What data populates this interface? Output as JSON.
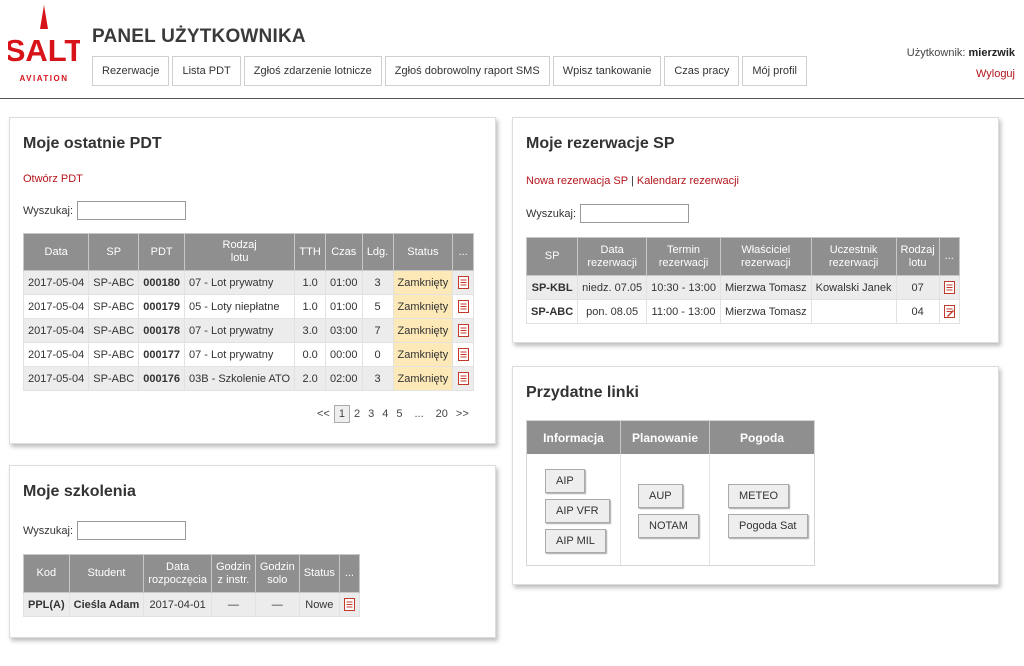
{
  "brand": {
    "logo_text": "SALT",
    "logo_subtext": "AVIATION",
    "accent_color": "#d7141a"
  },
  "header": {
    "title": "PANEL UŻYTKOWNIKA",
    "nav": [
      "Rezerwacje",
      "Lista PDT",
      "Zgłoś zdarzenie lotnicze",
      "Zgłoś dobrowolny raport SMS",
      "Wpisz tankowanie",
      "Czas pracy",
      "Mój profil"
    ],
    "user_label": "Użytkownik:",
    "username": "mierzwik",
    "logout": "Wyloguj"
  },
  "pdt": {
    "title": "Moje ostatnie PDT",
    "open_link": "Otwórz PDT",
    "search_label": "Wyszukaj:",
    "search_value": "",
    "columns": [
      "Data",
      "SP",
      "PDT",
      "Rodzaj lotu",
      "TTH",
      "Czas",
      "Ldg.",
      "Status",
      "..."
    ],
    "rows": [
      {
        "date": "2017-05-04",
        "sp": "SP-ABC",
        "pdt": "000180",
        "type": "07 - Lot prywatny",
        "tth": "1.0",
        "time": "01:00",
        "ldg": "3",
        "status": "Zamknięty"
      },
      {
        "date": "2017-05-04",
        "sp": "SP-ABC",
        "pdt": "000179",
        "type": "05 - Loty niepłatne",
        "tth": "1.0",
        "time": "01:00",
        "ldg": "5",
        "status": "Zamknięty"
      },
      {
        "date": "2017-05-04",
        "sp": "SP-ABC",
        "pdt": "000178",
        "type": "07 - Lot prywatny",
        "tth": "3.0",
        "time": "03:00",
        "ldg": "7",
        "status": "Zamknięty"
      },
      {
        "date": "2017-05-04",
        "sp": "SP-ABC",
        "pdt": "000177",
        "type": "07 - Lot prywatny",
        "tth": "0.0",
        "time": "00:00",
        "ldg": "0",
        "status": "Zamknięty"
      },
      {
        "date": "2017-05-04",
        "sp": "SP-ABC",
        "pdt": "000176",
        "type": "03B - Szkolenie ATO",
        "tth": "2.0",
        "time": "02:00",
        "ldg": "3",
        "status": "Zamknięty"
      }
    ],
    "pager": [
      "<<",
      "1",
      "2",
      "3",
      "4",
      "5",
      "...",
      "20",
      ">>"
    ],
    "pager_current": "1"
  },
  "training": {
    "title": "Moje szkolenia",
    "search_label": "Wyszukaj:",
    "search_value": "",
    "columns": [
      "Kod",
      "Student",
      "Data rozpoczęcia",
      "Godzin z instr.",
      "Godzin solo",
      "Status",
      "..."
    ],
    "rows": [
      {
        "code": "PPL(A)",
        "student": "Cieśla Adam",
        "start": "2017-04-01",
        "instr": "—",
        "solo": "—",
        "status": "Nowe"
      }
    ]
  },
  "reservations": {
    "title": "Moje rezerwacje SP",
    "new_link": "Nowa rezerwacja SP",
    "separator": "|",
    "calendar_link": "Kalendarz rezerwacji",
    "search_label": "Wyszukaj:",
    "search_value": "",
    "columns": [
      "SP",
      "Data rezerwacji",
      "Termin rezerwacji",
      "Właściciel rezerwacji",
      "Uczestnik rezerwacji",
      "Rodzaj lotu",
      "..."
    ],
    "rows": [
      {
        "sp": "SP-KBL",
        "date": "niedz. 07.05",
        "term": "10:30 - 13:00",
        "owner": "Mierzwa Tomasz",
        "participant": "Kowalski Janek",
        "type": "07"
      },
      {
        "sp": "SP-ABC",
        "date": "pon. 08.05",
        "term": "11:00 - 13:00",
        "owner": "Mierzwa Tomasz",
        "participant": "",
        "type": "04"
      }
    ]
  },
  "links": {
    "title": "Przydatne linki",
    "columns": [
      "Informacja",
      "Planowanie",
      "Pogoda"
    ],
    "informacja": [
      "AIP",
      "AIP VFR",
      "AIP MIL"
    ],
    "planowanie": [
      "AUP",
      "NOTAM"
    ],
    "pogoda": [
      "METEO",
      "Pogoda Sat"
    ]
  }
}
